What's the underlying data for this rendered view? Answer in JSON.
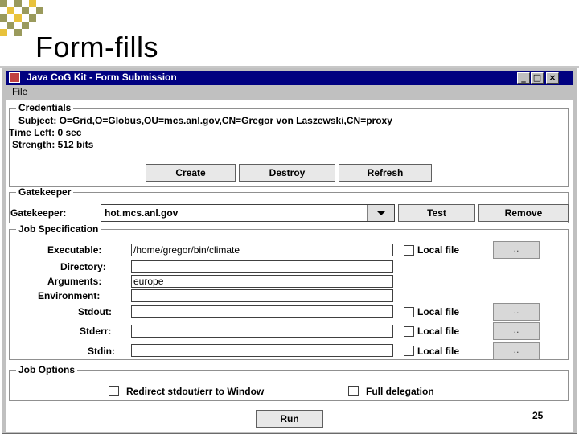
{
  "slide": {
    "title": "Form-fills",
    "page_number": "25"
  },
  "window": {
    "title": "Java CoG Kit - Form Submission",
    "menu": {
      "file": "File"
    }
  },
  "credentials": {
    "legend": "Credentials",
    "subject": "Subject: O=Grid,O=Globus,OU=mcs.anl.gov,CN=Gregor von Laszewski,CN=proxy",
    "time_left": "Time Left: 0 sec",
    "strength": "Strength: 512 bits",
    "buttons": {
      "create": "Create",
      "destroy": "Destroy",
      "refresh": "Refresh"
    }
  },
  "gatekeeper": {
    "legend": "Gatekeeper",
    "label": "Gatekeeper:",
    "value": "hot.mcs.anl.gov",
    "buttons": {
      "test": "Test",
      "remove": "Remove"
    }
  },
  "job_spec": {
    "legend": "Job Specification",
    "browse_label": "..",
    "local_file_label": "Local file",
    "executable": {
      "label": "Executable:",
      "value": "/home/gregor/bin/climate"
    },
    "directory": {
      "label": "Directory:",
      "value": ""
    },
    "arguments": {
      "label": "Arguments:",
      "value": "europe"
    },
    "environment": {
      "label": "Environment:",
      "value": ""
    },
    "stdout": {
      "label": "Stdout:",
      "value": ""
    },
    "stderr": {
      "label": "Stderr:",
      "value": ""
    },
    "stdin": {
      "label": "Stdin:",
      "value": ""
    }
  },
  "job_options": {
    "legend": "Job Options",
    "redirect": "Redirect stdout/err to Window",
    "full_delegation": "Full delegation"
  },
  "run_button": "Run",
  "colors": {
    "deco_olive": "#9a9a5c",
    "deco_gold": "#e8c23c",
    "titlebar": "#000080"
  }
}
